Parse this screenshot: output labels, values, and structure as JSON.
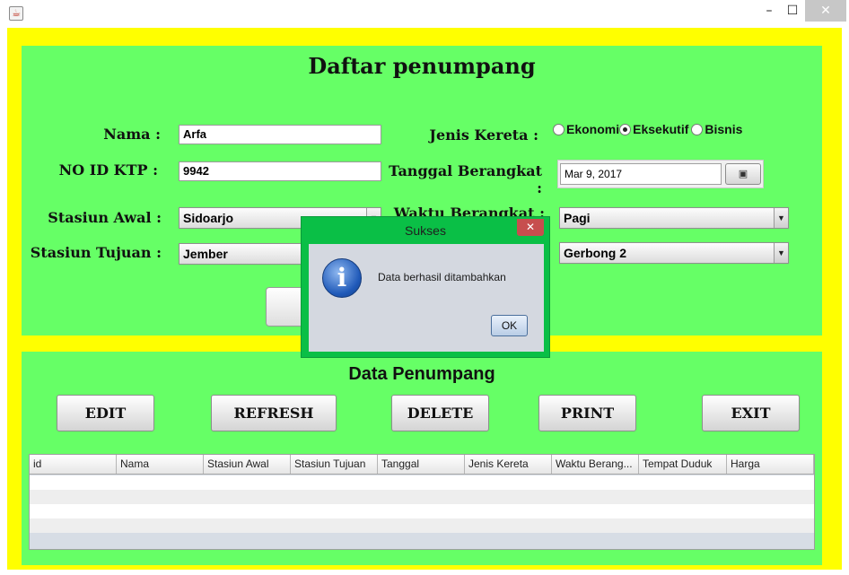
{
  "window": {
    "icon": "java-coffee-icon",
    "minimize_glyph": "–",
    "maximize_glyph": "☐",
    "close_glyph": "✕"
  },
  "form": {
    "title": "Daftar penumpang",
    "nama_label": "Nama :",
    "nama_value": "Arfa",
    "ktp_label": "NO ID KTP :",
    "ktp_value": "9942",
    "stasiun_awal_label": "Stasiun Awal :",
    "stasiun_awal_value": "Sidoarjo",
    "stasiun_tujuan_label": "Stasiun Tujuan :",
    "stasiun_tujuan_value": "Jember",
    "jenis_kereta_label": "Jenis Kereta :",
    "jenis_kereta_options": [
      "Ekonomi",
      "Eksekutif",
      "Bisnis"
    ],
    "jenis_kereta_selected": "Eksekutif",
    "tanggal_label": "Tanggal Berangkat :",
    "tanggal_value": "Mar 9, 2017",
    "waktu_label": "Waktu Berangkat :",
    "waktu_value": "Pagi",
    "gerbong_value": "Gerbong 2"
  },
  "data_section": {
    "title": "Data Penumpang",
    "buttons": [
      "EDIT",
      "REFRESH",
      "DELETE",
      "PRINT",
      "EXIT"
    ]
  },
  "table": {
    "columns": [
      "id",
      "Nama",
      "Stasiun Awal",
      "Stasiun Tujuan",
      "Tanggal",
      "Jenis Kereta",
      "Waktu Berang...",
      "Tempat Duduk",
      "Harga"
    ]
  },
  "dialog": {
    "title": "Sukses",
    "close_glyph": "✕",
    "icon": "info-icon",
    "icon_glyph": "i",
    "message": "Data berhasil ditambahkan",
    "ok_label": "OK"
  },
  "colors": {
    "frame": "#ffff00",
    "panel": "#66ff66",
    "dialog_border": "#0abf46"
  }
}
